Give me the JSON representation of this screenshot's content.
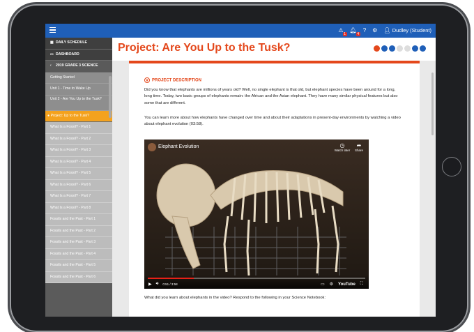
{
  "topbar": {
    "user": "Dudley (Student)",
    "badges": {
      "assignments": "1",
      "notifications": "4"
    }
  },
  "sidebar": {
    "items": [
      {
        "label": "DAILY SCHEDULE",
        "kind": "dark",
        "icon": "calendar-icon"
      },
      {
        "label": "DASHBOARD",
        "kind": "dark",
        "icon": "dashboard-icon"
      },
      {
        "label": "2019 GRADE 3 SCIENCE",
        "kind": "course",
        "icon": "chevron-left-icon"
      },
      {
        "label": "Getting Started",
        "kind": "unit"
      },
      {
        "label": "Unit 1 - Time to Wake Up",
        "kind": "unit"
      },
      {
        "label": "Unit 2 - Are You Up to the Tusk?",
        "kind": "unit2"
      },
      {
        "label": "Project: Up to the Tusk?",
        "kind": "active"
      },
      {
        "label": "What Is a Fossil? - Part 1",
        "kind": "lesson"
      },
      {
        "label": "What Is a Fossil? - Part 2",
        "kind": "lesson"
      },
      {
        "label": "What Is a Fossil? - Part 3",
        "kind": "lesson"
      },
      {
        "label": "What Is a Fossil? - Part 4",
        "kind": "lesson"
      },
      {
        "label": "What Is a Fossil? - Part 5",
        "kind": "lesson"
      },
      {
        "label": "What Is a Fossil? - Part 6",
        "kind": "lesson"
      },
      {
        "label": "What Is a Fossil? - Part 7",
        "kind": "lesson"
      },
      {
        "label": "What Is a Fossil? - Part 8",
        "kind": "lesson"
      },
      {
        "label": "Fossils and the Past - Part 1",
        "kind": "lesson"
      },
      {
        "label": "Fossils and the Past - Part 2",
        "kind": "lesson"
      },
      {
        "label": "Fossils and the Past - Part 3",
        "kind": "lesson"
      },
      {
        "label": "Fossils and the Past - Part 4",
        "kind": "lesson"
      },
      {
        "label": "Fossils and the Past - Part 5",
        "kind": "lesson"
      },
      {
        "label": "Fossils and the Past - Part 6",
        "kind": "lesson"
      }
    ]
  },
  "main": {
    "title": "Project: Are You Up to the Tusk?",
    "subject_icons": [
      "#e4481c",
      "#1f5fb8",
      "#1f5fb8",
      "#dddddd",
      "#dddddd",
      "#1f5fb8",
      "#1f5fb8"
    ],
    "section_heading": "PROJECT DESCRIPTION",
    "paragraph1": "Did you know that elephants are millions of years old? Well, no single elephant is that old, but elephant species have been around for a long, long time. Today, two basic groups of elephants remain: the African and the Asian elephant. They have many similar physical features but also some that are different.",
    "paragraph2": "You can learn more about how elephants have changed over time and about their adaptations in present-day environments by watching a video about elephant evolution (03:58).",
    "video": {
      "title": "Elephant Evolution",
      "watch_later": "Watch later",
      "share": "Share",
      "time": "0:51 / 3:58",
      "progress": 0.21,
      "brand": "YouTube"
    },
    "bottom_text": "What did you learn about elephants in the video? Respond to the following in your Science Notebook:"
  },
  "colors": {
    "brand_blue": "#1f5fb8",
    "accent_orange": "#e4481c",
    "active_item": "#f4a21e"
  }
}
